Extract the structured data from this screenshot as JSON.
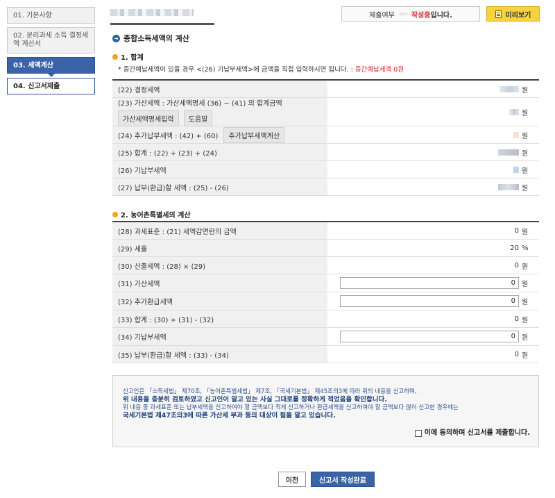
{
  "sidebar": {
    "steps": [
      {
        "label": "01. 기본사항"
      },
      {
        "label": "02. 분리과세 소득 결정세액 계산서"
      },
      {
        "label": "03. 세액계산"
      },
      {
        "label": "04. 신고서제출"
      }
    ]
  },
  "header": {
    "status_label": "제출여부",
    "status_arrows": "››››",
    "status_value": "작성중",
    "status_suffix": "입니다.",
    "preview_label": "미리보기"
  },
  "section": {
    "title": "종합소득세액의 계산",
    "sub1": "1. 합계",
    "note_prefix": "* 중간예납세액이 있을 경우 <(26) 기납부세액>에 금액을 직접 입력하시면 됩니다. : ",
    "note_red": "중간예납세액 0원",
    "sub2": "2. 농어촌특별세의 계산"
  },
  "table1": [
    {
      "label": "(22) 결정세액",
      "unit": "원"
    },
    {
      "label": "(23) 가산세액 : 가산세액명세 (36) ~ (41) 의 합계금액",
      "btn1": "가산세액명세입력",
      "btn2": "도움말",
      "unit": "원"
    },
    {
      "label": "(24) 추가납부세액 : (42) + (60)",
      "btn1": "추가납부세액계산",
      "unit": "원"
    },
    {
      "label": "(25) 합계 : (22) + (23) + (24)",
      "unit": "원"
    },
    {
      "label": "(26) 기납부세액",
      "unit": "원"
    },
    {
      "label": "(27) 납부(환급)할 세액 : (25) - (26)",
      "unit": "원"
    }
  ],
  "table2": [
    {
      "label": "(28) 과세표준 : (21) 세액감면란의 금액",
      "value": "0",
      "unit": "원"
    },
    {
      "label": "(29) 세율",
      "value": "20",
      "unit": "%"
    },
    {
      "label": "(30) 산출세액 : (28) × (29)",
      "value": "0",
      "unit": "원"
    },
    {
      "label": "(31) 가산세액",
      "value": "0",
      "unit": "원",
      "input": true
    },
    {
      "label": "(32) 추가환급세액",
      "value": "0",
      "unit": "원",
      "input": true
    },
    {
      "label": "(33) 합계 : (30) + (31) - (32)",
      "value": "0",
      "unit": "원"
    },
    {
      "label": "(34) 기납부세액",
      "value": "0",
      "unit": "원",
      "input": true
    },
    {
      "label": "(35) 납부(환급)할 세액 : (33) - (34)",
      "value": "0",
      "unit": "원"
    }
  ],
  "agreement": {
    "line1": "신고인은 「소득세법」 제70조, 「농어촌특별세법」 제7조, 「국세기본법」 제45조의3에 따라 위의 내용을 신고하며,",
    "line2": "위 내용을 충분히 검토하였고 신고인이 알고 있는 사실 그대로를 정확하게 적었음을 확인합니다.",
    "line3": "위 내용 중 과세표준 또는 납부세액을 신고하여야 할 금액보다 적게 신고하거나 환급세액을 신고하여야 할 금액보다 많이 신고한 경우에는",
    "line4": "국세기본법 제47조의3에 따른 가산세 부과 등의 대상이 됨을 알고 있습니다.",
    "checkbox_label": "이에 동의하며 신고서를 제출합니다."
  },
  "footer": {
    "prev_label": "이전",
    "done_label": "신고서 작성완료"
  }
}
